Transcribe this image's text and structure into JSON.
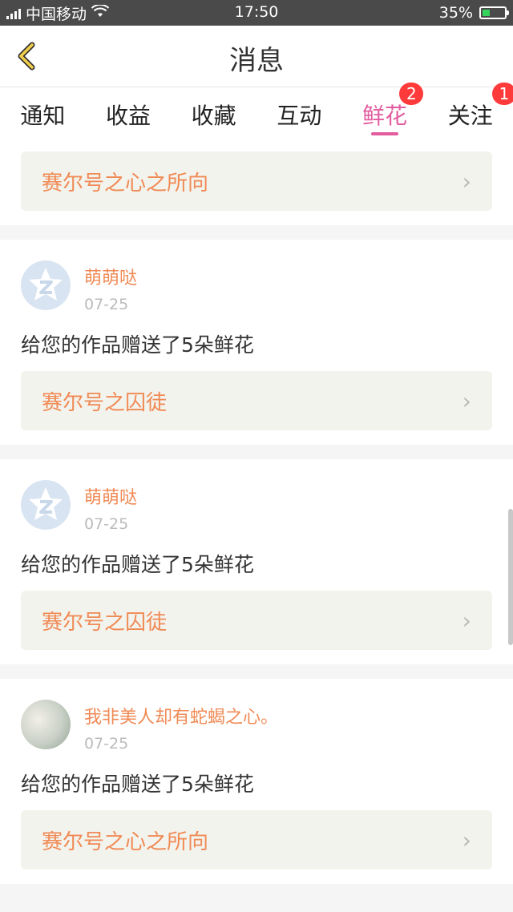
{
  "status_bar": {
    "carrier": "中国移动",
    "time": "17:50",
    "battery_percent": "35%",
    "battery_level": 0.35
  },
  "header": {
    "title": "消息"
  },
  "tabs": [
    {
      "label": "通知",
      "badge": ""
    },
    {
      "label": "收益",
      "badge": ""
    },
    {
      "label": "收藏",
      "badge": ""
    },
    {
      "label": "互动",
      "badge": ""
    },
    {
      "label": "鲜花",
      "badge": "2",
      "active": true
    },
    {
      "label": "关注",
      "badge": "1"
    }
  ],
  "feed": {
    "top_work": "赛尔号之心之所向",
    "items": [
      {
        "username": "萌萌哒",
        "date": "07-25",
        "message": "给您的作品赠送了5朵鲜花",
        "work": "赛尔号之囚徒",
        "avatar": "default-z-icon"
      },
      {
        "username": "萌萌哒",
        "date": "07-25",
        "message": "给您的作品赠送了5朵鲜花",
        "work": "赛尔号之囚徒",
        "avatar": "default-z-icon"
      },
      {
        "username": "我非美人却有蛇蝎之心。",
        "date": "07-25",
        "message": "给您的作品赠送了5朵鲜花",
        "work": "赛尔号之心之所向",
        "avatar": "photo-avatar"
      }
    ]
  },
  "colors": {
    "accent_pink": "#e25c9f",
    "username_orange": "#f08a55",
    "badge_red": "#ff3a3a"
  }
}
